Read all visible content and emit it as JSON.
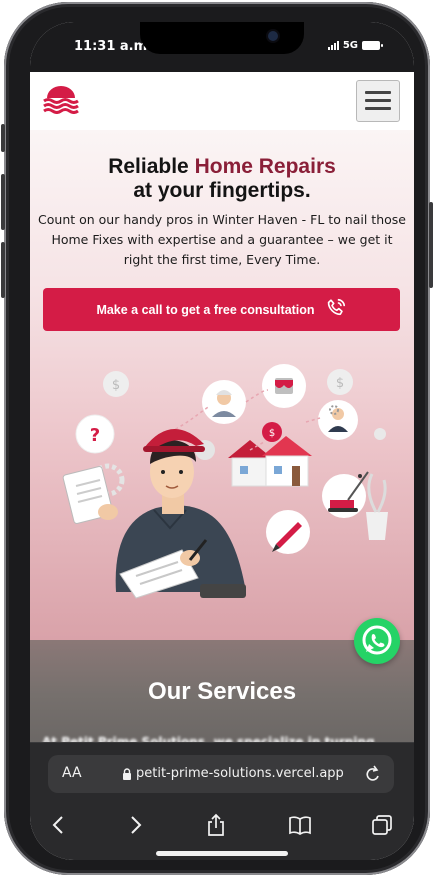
{
  "status_bar": {
    "time": "11:31 a.m.",
    "network": "5G"
  },
  "header": {
    "logo_icon": "waves-logo-icon",
    "menu_icon": "hamburger-menu-icon"
  },
  "hero": {
    "title_prefix": "Reliable ",
    "title_accent": "Home Repairs",
    "title_line2": "at your fingertips.",
    "description": "Count on our handy pros in Winter Haven - FL to nail those Home Fixes with expertise and a guarantee – we get it right the first time, Every Time.",
    "cta_label": "Make a call to get a free consultation",
    "cta_icon": "phone-call-icon",
    "illustration": "repairman-home-services-illustration"
  },
  "services": {
    "title": "Our Services",
    "subtitle": "At Petit Prime Solutions, we specialize in turning"
  },
  "whatsapp": {
    "icon": "whatsapp-icon"
  },
  "browser": {
    "text_size_label": "AA",
    "url": "petit-prime-solutions.vercel.app",
    "toolbar_icons": [
      "back-icon",
      "forward-icon",
      "share-icon",
      "bookmarks-icon",
      "tabs-icon"
    ]
  },
  "colors": {
    "accent": "#d41c46",
    "title_accent": "#8a1f38",
    "whatsapp": "#25d366"
  }
}
